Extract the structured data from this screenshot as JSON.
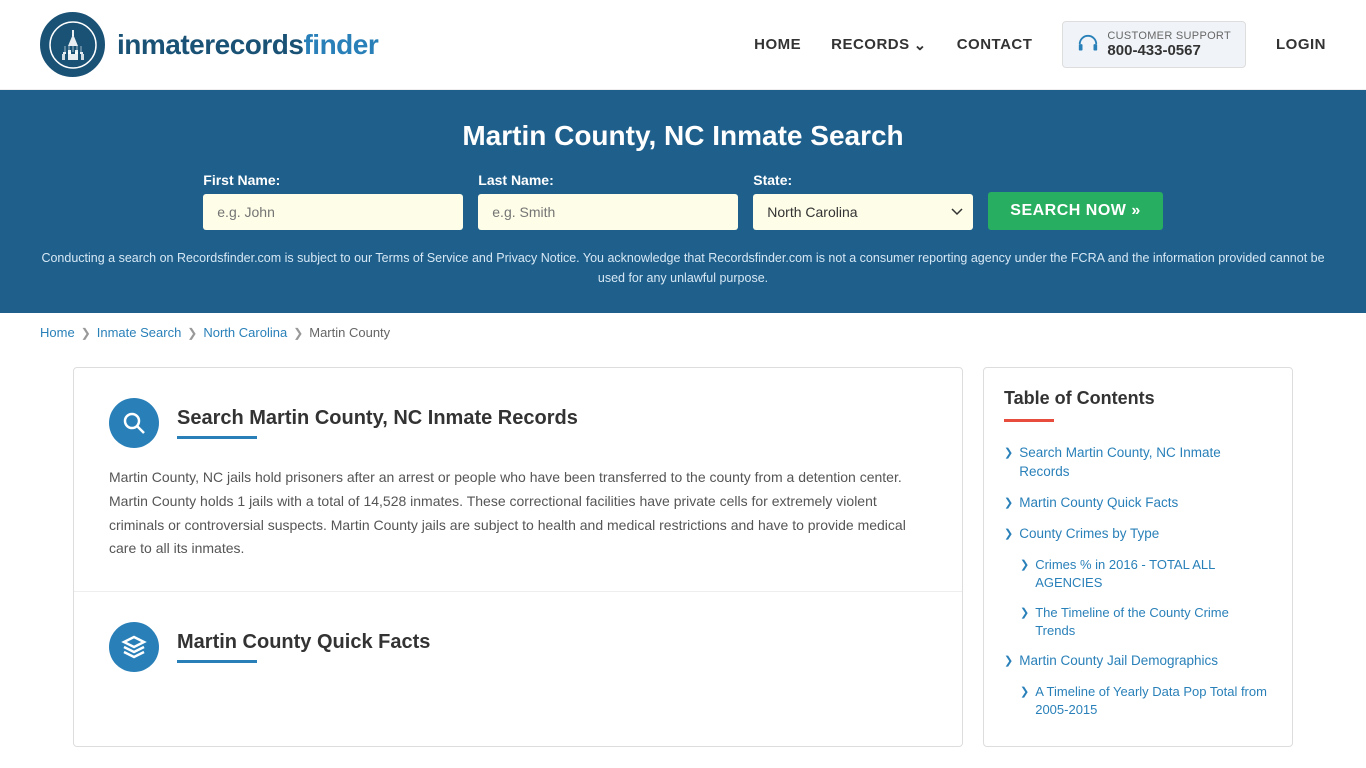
{
  "header": {
    "logo_text_main": "inmaterecords",
    "logo_text_bold": "finder",
    "nav": {
      "home": "HOME",
      "records": "RECORDS",
      "contact": "CONTACT",
      "login": "LOGIN"
    },
    "support": {
      "label": "CUSTOMER SUPPORT",
      "phone": "800-433-0567"
    }
  },
  "hero": {
    "title": "Martin County, NC Inmate Search",
    "form": {
      "first_name_label": "First Name:",
      "first_name_placeholder": "e.g. John",
      "last_name_label": "Last Name:",
      "last_name_placeholder": "e.g. Smith",
      "state_label": "State:",
      "state_value": "North Carolina",
      "search_button": "SEARCH NOW »"
    },
    "disclaimer": "Conducting a search on Recordsfinder.com is subject to our Terms of Service and Privacy Notice. You acknowledge that Recordsfinder.com is not a consumer reporting agency under the FCRA and the information provided cannot be used for any unlawful purpose."
  },
  "breadcrumb": {
    "items": [
      "Home",
      "Inmate Search",
      "North Carolina",
      "Martin County"
    ]
  },
  "main_section": {
    "title": "Search Martin County, NC Inmate Records",
    "body": "Martin County, NC jails hold prisoners after an arrest or people who have been transferred to the county from a detention center. Martin County holds 1 jails with a total of 14,528 inmates. These correctional facilities have private cells for extremely violent criminals or controversial suspects. Martin County jails are subject to health and medical restrictions and have to provide medical care to all its inmates."
  },
  "quick_facts_section": {
    "title": "Martin County Quick Facts"
  },
  "toc": {
    "title": "Table of Contents",
    "items": [
      {
        "label": "Search Martin County, NC Inmate Records",
        "subitems": []
      },
      {
        "label": "Martin County Quick Facts",
        "subitems": []
      },
      {
        "label": "County Crimes by Type",
        "subitems": []
      },
      {
        "label": "Crimes % in 2016 - TOTAL ALL AGENCIES",
        "subitems": []
      },
      {
        "label": "The Timeline of the County Crime Trends",
        "subitems": []
      },
      {
        "label": "Martin County Jail Demographics",
        "subitems": []
      },
      {
        "label": "A Timeline of Yearly Data Pop Total from 2005-2015",
        "subitems": []
      }
    ]
  }
}
